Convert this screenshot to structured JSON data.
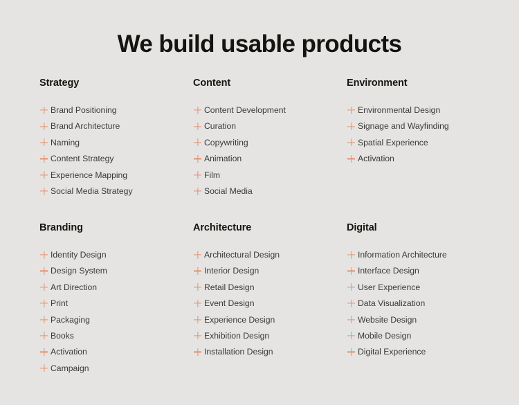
{
  "page": {
    "background_color": "#e5e4e3",
    "title": "We build usable products",
    "title_color": "#15130f",
    "accent_color": "#e4906c",
    "item_text_color": "#3b3a38"
  },
  "categories": [
    {
      "id": "strategy",
      "title": "Strategy",
      "items": [
        {
          "icon": "plus-icon",
          "label": "Brand Positioning"
        },
        {
          "icon": "plus-icon",
          "label": "Brand Architecture"
        },
        {
          "icon": "plus-icon",
          "label": "Naming"
        },
        {
          "icon": "plus-icon",
          "label": "Content Strategy"
        },
        {
          "icon": "plus-icon",
          "label": "Experience Mapping"
        },
        {
          "icon": "plus-icon",
          "label": "Social Media Strategy"
        }
      ]
    },
    {
      "id": "content",
      "title": "Content",
      "items": [
        {
          "icon": "plus-icon",
          "label": "Content Development"
        },
        {
          "icon": "plus-icon",
          "label": "Curation"
        },
        {
          "icon": "plus-icon",
          "label": "Copywriting"
        },
        {
          "icon": "plus-icon",
          "label": "Animation"
        },
        {
          "icon": "plus-icon",
          "label": "Film"
        },
        {
          "icon": "plus-icon",
          "label": "Social Media"
        }
      ]
    },
    {
      "id": "environment",
      "title": "Environment",
      "items": [
        {
          "icon": "plus-icon",
          "label": "Environmental Design"
        },
        {
          "icon": "plus-icon",
          "label": "Signage and Wayfinding"
        },
        {
          "icon": "plus-icon",
          "label": "Spatial Experience"
        },
        {
          "icon": "plus-icon",
          "label": "Activation"
        }
      ]
    },
    {
      "id": "branding",
      "title": "Branding",
      "items": [
        {
          "icon": "plus-icon",
          "label": "Identity Design"
        },
        {
          "icon": "plus-icon",
          "label": "Design System"
        },
        {
          "icon": "plus-icon",
          "label": "Art Direction"
        },
        {
          "icon": "plus-icon",
          "label": "Print"
        },
        {
          "icon": "plus-icon",
          "label": "Packaging"
        },
        {
          "icon": "plus-icon",
          "label": "Books"
        },
        {
          "icon": "plus-icon",
          "label": "Activation"
        },
        {
          "icon": "plus-icon",
          "label": "Campaign"
        }
      ]
    },
    {
      "id": "architecture",
      "title": "Architecture",
      "items": [
        {
          "icon": "plus-icon",
          "label": "Architectural Design"
        },
        {
          "icon": "plus-icon",
          "label": "Interior Design"
        },
        {
          "icon": "plus-icon",
          "label": "Retail Design"
        },
        {
          "icon": "plus-icon",
          "label": "Event Design"
        },
        {
          "icon": "plus-icon",
          "label": "Experience Design"
        },
        {
          "icon": "plus-icon",
          "label": "Exhibition Design"
        },
        {
          "icon": "plus-icon",
          "label": "Installation Design"
        }
      ]
    },
    {
      "id": "digital",
      "title": "Digital",
      "items": [
        {
          "icon": "plus-icon",
          "label": "Information Architecture"
        },
        {
          "icon": "plus-icon",
          "label": "Interface Design"
        },
        {
          "icon": "plus-icon",
          "label": "User Experience"
        },
        {
          "icon": "plus-icon",
          "label": "Data Visualization"
        },
        {
          "icon": "plus-icon",
          "label": "Website Design"
        },
        {
          "icon": "plus-icon",
          "label": "Mobile Design"
        },
        {
          "icon": "plus-icon",
          "label": "Digital Experience"
        }
      ]
    }
  ]
}
